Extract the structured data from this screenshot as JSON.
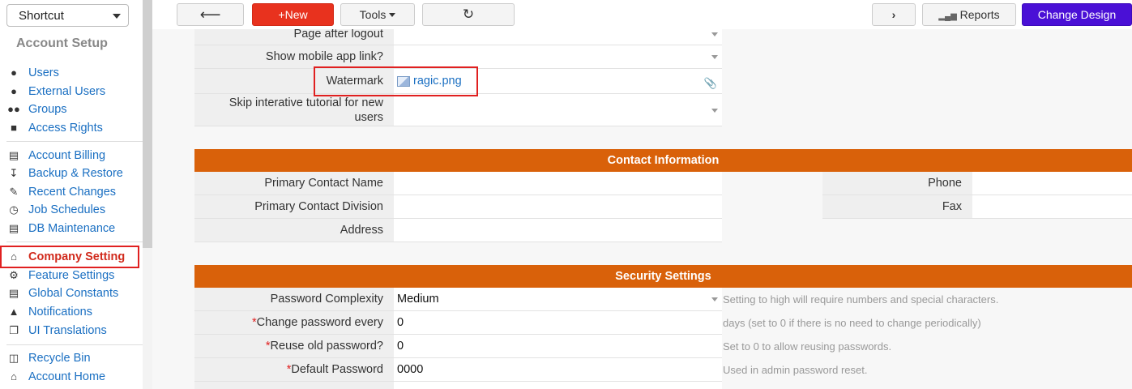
{
  "sidebar": {
    "shortcut_label": "Shortcut",
    "section_title": "Account Setup",
    "items": [
      {
        "label": "Users",
        "icon": "user-icon"
      },
      {
        "label": "External Users",
        "icon": "user-icon"
      },
      {
        "label": "Groups",
        "icon": "users-icon"
      },
      {
        "label": "Access Rights",
        "icon": "lock-icon"
      },
      {
        "label": "Account Billing",
        "icon": "billing-icon"
      },
      {
        "label": "Backup & Restore",
        "icon": "download-icon"
      },
      {
        "label": "Recent Changes",
        "icon": "edit-icon"
      },
      {
        "label": "Job Schedules",
        "icon": "clock-icon"
      },
      {
        "label": "DB Maintenance",
        "icon": "database-icon"
      },
      {
        "label": "Company Setting",
        "icon": "bank-icon"
      },
      {
        "label": "Feature Settings",
        "icon": "gear-icon"
      },
      {
        "label": "Global Constants",
        "icon": "database-icon"
      },
      {
        "label": "Notifications",
        "icon": "bell-icon"
      },
      {
        "label": "UI Translations",
        "icon": "copy-icon"
      },
      {
        "label": "Recycle Bin",
        "icon": "trash-icon"
      },
      {
        "label": "Account Home",
        "icon": "home-icon"
      }
    ]
  },
  "toolbar": {
    "new_label": "+New",
    "tools_label": "Tools",
    "reports_label": "Reports",
    "design_label": "Change Design"
  },
  "form": {
    "rows": [
      {
        "label": "Page after logout",
        "value": ""
      },
      {
        "label": "Show mobile app link?",
        "value": ""
      },
      {
        "label": "Watermark",
        "value": "ragic.png"
      },
      {
        "label": "Skip interative tutorial for new users",
        "value": ""
      }
    ],
    "contact": {
      "title": "Contact Information",
      "left": [
        {
          "label": "Primary Contact Name",
          "value": ""
        },
        {
          "label": "Primary Contact Division",
          "value": ""
        },
        {
          "label": "Address",
          "value": ""
        }
      ],
      "right": [
        {
          "label": "Phone",
          "value": ""
        },
        {
          "label": "Fax",
          "value": ""
        }
      ]
    },
    "security": {
      "title": "Security Settings",
      "rows": [
        {
          "label": "Password Complexity",
          "required": "",
          "value": "Medium",
          "help": "Setting to high will require numbers and special characters."
        },
        {
          "label": "Change password every",
          "required": "*",
          "value": "0",
          "help": "days (set to 0 if there is no need to change periodically)"
        },
        {
          "label": "Reuse old password?",
          "required": "*",
          "value": "0",
          "help": "Set to 0 to allow reusing passwords."
        },
        {
          "label": "Default Password",
          "required": "*",
          "value": "0000",
          "help": "Used in admin password reset."
        }
      ]
    }
  }
}
